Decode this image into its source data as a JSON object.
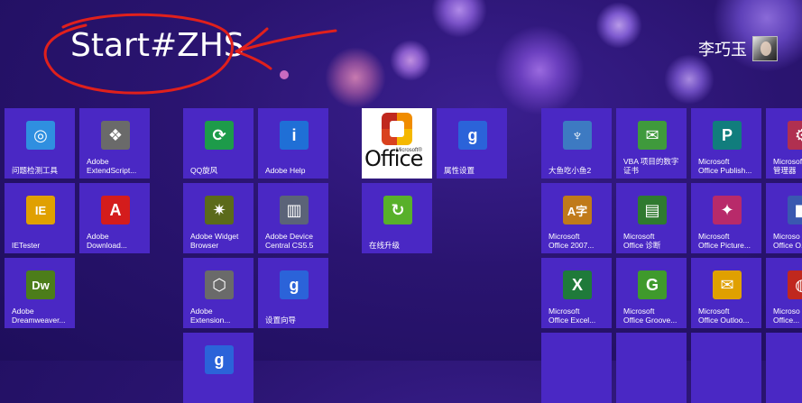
{
  "start": {
    "title": "Start#ZHS",
    "user_name": "李巧玉"
  },
  "colors": {
    "background": "#2a1470",
    "tile": "#4a28c4",
    "annotation": "#e0201c"
  },
  "tiles": [
    {
      "label": "问题检测工具",
      "icon": "network-diagnostic-icon",
      "glyph": "◎",
      "icon_bg": "#2f8fe0"
    },
    {
      "label": "Adobe\nExtendScript...",
      "icon": "extendscript-icon",
      "glyph": "❖",
      "icon_bg": "#6a6a6a"
    },
    {
      "label": "QQ旋风",
      "icon": "qq-whirlwind-icon",
      "glyph": "⟳",
      "icon_bg": "#1d9b4a"
    },
    {
      "label": "Adobe Help",
      "icon": "adobe-help-icon",
      "glyph": "i",
      "icon_bg": "#1f6fd6"
    },
    {
      "label": "",
      "icon": "microsoft-office-logo",
      "glyph": "",
      "icon_bg": "#ffffff"
    },
    {
      "label": "属性设置",
      "icon": "properties-settings-icon",
      "glyph": "g",
      "icon_bg": "#2b63d9"
    },
    {
      "label": "大鱼吃小鱼2",
      "icon": "big-fish-icon",
      "glyph": "♆",
      "icon_bg": "#3d7ac2"
    },
    {
      "label": "VBA 项目的数字\n证书",
      "icon": "vba-certificate-icon",
      "glyph": "✉",
      "icon_bg": "#3f9a3c"
    },
    {
      "label": "Microsoft\nOffice Publish...",
      "icon": "publisher-icon",
      "glyph": "P",
      "icon_bg": "#117d7d"
    },
    {
      "label": "Microsoft\n管理器",
      "icon": "office-manager-icon",
      "glyph": "⚙",
      "icon_bg": "#b03050"
    },
    {
      "label": "IETester",
      "icon": "ietester-icon",
      "glyph": "IE",
      "icon_bg": "#e0a000"
    },
    {
      "label": "Adobe\nDownload...",
      "icon": "adobe-download-icon",
      "glyph": "A",
      "icon_bg": "#d41c1c"
    },
    {
      "label": "Adobe Widget\nBrowser",
      "icon": "widget-browser-icon",
      "glyph": "✷",
      "icon_bg": "#5b6a1a"
    },
    {
      "label": "Adobe Device\nCentral CS5.5",
      "icon": "device-central-icon",
      "glyph": "▥",
      "icon_bg": "#5b6378"
    },
    {
      "label": "在线升级",
      "icon": "online-upgrade-icon",
      "glyph": "↻",
      "icon_bg": "#58b02a"
    },
    {
      "label": "Microsoft\nOffice 2007...",
      "icon": "office-language-icon",
      "glyph": "A字",
      "icon_bg": "#c07a1a"
    },
    {
      "label": "Microsoft\nOffice 诊断",
      "icon": "office-diagnostics-icon",
      "glyph": "▤",
      "icon_bg": "#2f7a2f"
    },
    {
      "label": "Microsoft\nOffice Picture...",
      "icon": "picture-manager-icon",
      "glyph": "✦",
      "icon_bg": "#b82a6a"
    },
    {
      "label": "Microso\nOffice O...",
      "icon": "office-partial-icon",
      "glyph": "◧",
      "icon_bg": "#3a58b0"
    },
    {
      "label": "Adobe\nDreamweaver...",
      "icon": "dreamweaver-icon",
      "glyph": "Dw",
      "icon_bg": "#4c7d1a"
    },
    {
      "label": "Adobe\nExtension...",
      "icon": "extension-manager-icon",
      "glyph": "⬡",
      "icon_bg": "#6a6a6a"
    },
    {
      "label": "设置向导",
      "icon": "setup-wizard-icon",
      "glyph": "g",
      "icon_bg": "#2b63d9"
    },
    {
      "label": "Microsoft\nOffice Excel...",
      "icon": "excel-icon",
      "glyph": "X",
      "icon_bg": "#1f7a3a"
    },
    {
      "label": "Microsoft\nOffice Groove...",
      "icon": "groove-icon",
      "glyph": "G",
      "icon_bg": "#3f9a2c"
    },
    {
      "label": "Microsoft\nOffice Outloo...",
      "icon": "outlook-icon",
      "glyph": "✉",
      "icon_bg": "#e0a000"
    },
    {
      "label": "Microso\nOffice...",
      "icon": "office-partial-icon-2",
      "glyph": "◍",
      "icon_bg": "#c0281e"
    },
    {
      "label": "",
      "icon": "partial-tile-icon",
      "glyph": "g",
      "icon_bg": "#2b63d9"
    },
    {
      "label": "",
      "icon": "partial-tile-icon-2",
      "glyph": "",
      "icon_bg": "#4a28c4"
    },
    {
      "label": "",
      "icon": "partial-tile-icon-3",
      "glyph": "",
      "icon_bg": "#4a28c4"
    },
    {
      "label": "",
      "icon": "partial-tile-icon-4",
      "glyph": "",
      "icon_bg": "#4a28c4"
    },
    {
      "label": "",
      "icon": "partial-tile-icon-5",
      "glyph": "",
      "icon_bg": "#4a28c4"
    }
  ],
  "office_tile": {
    "word": "Office",
    "brand": "Microsoft®"
  }
}
